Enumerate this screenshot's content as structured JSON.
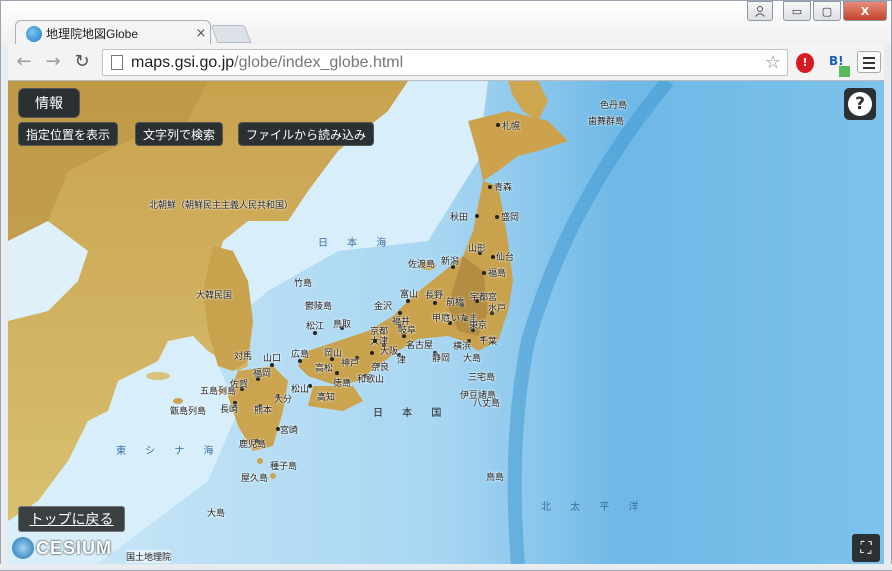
{
  "browser": {
    "tab_title": "地理院地図Globe",
    "tab_close": "×",
    "url_host": "maps.gsi.go.jp",
    "url_path": "/globe/index_globe.html",
    "back_icon": "arrow-left-icon",
    "forward_icon": "arrow-right-icon",
    "reload_icon": "reload-icon",
    "star_glyph": "☆",
    "win_min": "▭",
    "win_max": "▢",
    "win_close": "X",
    "ext2_label": "B!"
  },
  "map_ui": {
    "info_button": "情報",
    "buttons": [
      "指定位置を表示",
      "文字列で検索",
      "ファイルから読み込み"
    ],
    "help_glyph": "?",
    "top_button": "トップに戻る",
    "cesium_text": "CESIUM",
    "credit": "国土地理院",
    "fullscreen_glyph": "⛶"
  },
  "map_labels": {
    "sea_japan": "日 本 海",
    "east_china_sea": "東 シ ナ 海",
    "pacific": "北 太 平 洋",
    "japan": "日 本 国",
    "north_korea": "北朝鮮（朝鮮民主主義人民共和国）",
    "south_korea": "大韓民国",
    "takeshima": "竹島",
    "ulleung": "鬱陵島",
    "tsushima": "対馬",
    "goto": "五島列島",
    "koshiki": "甑島列島",
    "tanegashima": "種子島",
    "yakushima": "屋久島",
    "izu": "伊豆諸島",
    "hachijo": "八丈島",
    "miyake": "三宅島",
    "oshima": "大島",
    "sado": "佐渡島",
    "rishiri": "色丹島",
    "habomai": "歯舞群島",
    "toshima": "鳥島",
    "amami": "大島",
    "cities": {
      "sapporo": "札幌",
      "aomori": "青森",
      "akita": "秋田",
      "morioka": "盛岡",
      "yamagata": "山形",
      "sendai": "仙台",
      "niigata": "新潟",
      "fukushima": "福島",
      "toyama": "富山",
      "nagano": "長野",
      "maebashi": "前橋",
      "utsunomiya": "宇都宮",
      "kanazawa": "金沢",
      "fukui": "福井",
      "kofu": "甲府",
      "saitama": "さいたま",
      "mito": "水戸",
      "tokyo": "東京",
      "chiba": "千葉",
      "yokohama": "横浜",
      "shizuoka": "静岡",
      "gifu": "岐阜",
      "nagoya": "名古屋",
      "tsu": "津",
      "otsu": "大津",
      "kyoto": "京都",
      "osaka": "大阪",
      "kobe": "神戸",
      "nara": "奈良",
      "wakayama": "和歌山",
      "tottori": "鳥取",
      "matsue": "松江",
      "okayama": "岡山",
      "hiroshima": "広島",
      "yamaguchi": "山口",
      "takamatsu": "高松",
      "tokushima": "徳島",
      "matsuyama": "松山",
      "kochi": "高知",
      "fukuoka": "福岡",
      "saga": "佐賀",
      "nagasaki": "長崎",
      "kumamoto": "熊本",
      "oita": "大分",
      "miyazaki": "宮崎",
      "kagoshima": "鹿児島"
    }
  }
}
